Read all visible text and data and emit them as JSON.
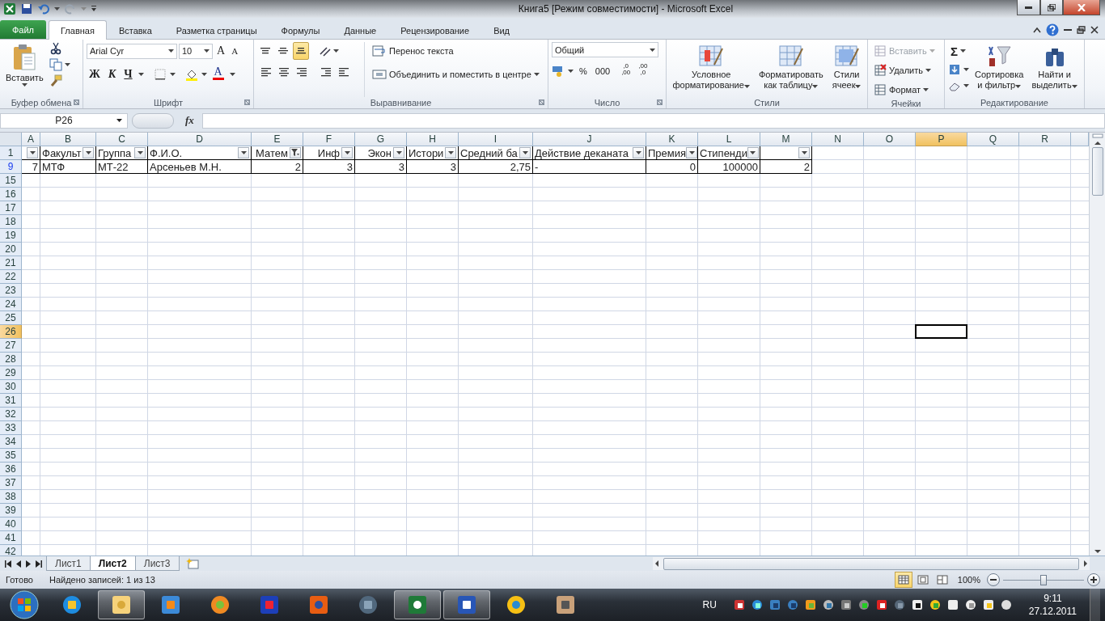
{
  "window": {
    "title": "Книга5  [Режим совместимости]  -  Microsoft Excel"
  },
  "tabs": [
    {
      "label": "Файл",
      "kind": "file",
      "selected": false
    },
    {
      "label": "Главная",
      "kind": "tab",
      "selected": true
    },
    {
      "label": "Вставка",
      "kind": "tab",
      "selected": false
    },
    {
      "label": "Разметка страницы",
      "kind": "tab",
      "selected": false
    },
    {
      "label": "Формулы",
      "kind": "tab",
      "selected": false
    },
    {
      "label": "Данные",
      "kind": "tab",
      "selected": false
    },
    {
      "label": "Рецензирование",
      "kind": "tab",
      "selected": false
    },
    {
      "label": "Вид",
      "kind": "tab",
      "selected": false
    }
  ],
  "ribbon": {
    "clipboard": {
      "title": "Буфер обмена",
      "paste": "Вставить"
    },
    "font": {
      "title": "Шрифт",
      "name": "Arial Cyr",
      "size": "10",
      "grow": "A",
      "shrink": "A",
      "bold": "Ж",
      "italic": "К",
      "underline": "Ч",
      "color_letter": "A"
    },
    "alignment": {
      "title": "Выравнивание",
      "wrap": "Перенос текста",
      "merge": "Объединить и поместить в центре",
      "vertical": [
        {
          "selected": false
        },
        {
          "selected": false
        },
        {
          "selected": true
        }
      ]
    },
    "number": {
      "title": "Число",
      "format": "Общий",
      "percent": "%",
      "thousands": "000",
      "more_decimals": [
        ",0",
        ",00"
      ],
      "fewer_decimals": [
        ",00",
        ",0"
      ]
    },
    "styles": {
      "title": "Стили",
      "buttons": [
        {
          "lines": [
            "Условное",
            "форматирование"
          ]
        },
        {
          "lines": [
            "Форматировать",
            "как таблицу"
          ]
        },
        {
          "lines": [
            "Стили",
            "ячеек"
          ]
        }
      ]
    },
    "cells": {
      "title": "Ячейки",
      "buttons": [
        {
          "label": "Вставить",
          "disabled": true
        },
        {
          "label": "Удалить",
          "disabled": false
        },
        {
          "label": "Формат",
          "disabled": false
        }
      ]
    },
    "editing": {
      "title": "Редактирование",
      "sigma": "Σ",
      "buttons": [
        {
          "lines": [
            "Сортировка",
            "и фильтр"
          ]
        },
        {
          "lines": [
            "Найти и",
            "выделить"
          ]
        }
      ]
    }
  },
  "formula_bar": {
    "name_box": "P26",
    "function_label": "fx"
  },
  "sheet": {
    "columns": [
      {
        "label": "A",
        "selected": false
      },
      {
        "label": "B",
        "selected": false
      },
      {
        "label": "C",
        "selected": false
      },
      {
        "label": "D",
        "selected": false
      },
      {
        "label": "E",
        "selected": false
      },
      {
        "label": "F",
        "selected": false
      },
      {
        "label": "G",
        "selected": false
      },
      {
        "label": "H",
        "selected": false
      },
      {
        "label": "I",
        "selected": false
      },
      {
        "label": "J",
        "selected": false
      },
      {
        "label": "K",
        "selected": false
      },
      {
        "label": "L",
        "selected": false
      },
      {
        "label": "M",
        "selected": false
      },
      {
        "label": "N",
        "selected": false
      },
      {
        "label": "O",
        "selected": false
      },
      {
        "label": "P",
        "selected": true
      },
      {
        "label": "Q",
        "selected": false
      },
      {
        "label": "R",
        "selected": false
      }
    ],
    "rows": [
      {
        "number": "1",
        "selected": false,
        "filtered": false,
        "cells": [
          {
            "right_aligned": false,
            "filter": true,
            "filter_applied": false
          },
          {
            "text": "Факульт",
            "right_aligned": false,
            "filter": true,
            "filter_applied": false
          },
          {
            "text": "Группа",
            "right_aligned": false,
            "filter": true,
            "filter_applied": false
          },
          {
            "text": "Ф.И.О.",
            "right_aligned": false,
            "filter": true,
            "filter_applied": false
          },
          {
            "text": "Матем",
            "right_aligned": true,
            "filter": true,
            "filter_applied": true
          },
          {
            "text": "Инф",
            "right_aligned": true,
            "filter": true,
            "filter_applied": false
          },
          {
            "text": "Экон",
            "right_aligned": true,
            "filter": true,
            "filter_applied": false
          },
          {
            "text": "Истори",
            "right_aligned": false,
            "filter": true,
            "filter_applied": false
          },
          {
            "text": "Средний ба",
            "right_aligned": false,
            "filter": true,
            "filter_applied": false
          },
          {
            "text": "Действие деканата",
            "right_aligned": false,
            "filter": true,
            "filter_applied": false
          },
          {
            "text": "Премия",
            "right_aligned": false,
            "filter": true,
            "filter_applied": false
          },
          {
            "text": "Стипенди",
            "right_aligned": false,
            "filter": true,
            "filter_applied": false
          },
          {
            "right_aligned": false,
            "filter": true,
            "filter_applied": false
          }
        ]
      },
      {
        "number": "9",
        "selected": false,
        "filtered": true,
        "cells": [
          {
            "text": "7",
            "right_aligned": true,
            "filter": false
          },
          {
            "text": "МТФ",
            "right_aligned": false,
            "filter": false
          },
          {
            "text": "МТ-22",
            "right_aligned": false,
            "filter": false
          },
          {
            "text": "Арсеньев М.Н.",
            "right_aligned": false,
            "filter": false
          },
          {
            "text": "2",
            "right_aligned": true,
            "filter": false
          },
          {
            "text": "3",
            "right_aligned": true,
            "filter": false
          },
          {
            "text": "3",
            "right_aligned": true,
            "filter": false
          },
          {
            "text": "3",
            "right_aligned": true,
            "filter": false
          },
          {
            "text": "2,75",
            "right_aligned": true,
            "filter": false
          },
          {
            "text": "-",
            "right_aligned": false,
            "filter": false
          },
          {
            "text": "0",
            "right_aligned": true,
            "filter": false
          },
          {
            "text": "100000",
            "right_aligned": true,
            "filter": false
          },
          {
            "text": "2",
            "right_aligned": true,
            "filter": false
          }
        ]
      },
      {
        "number": "15",
        "selected": false,
        "filtered": false
      },
      {
        "number": "16",
        "selected": false,
        "filtered": false
      },
      {
        "number": "17",
        "selected": false,
        "filtered": false
      },
      {
        "number": "18",
        "selected": false,
        "filtered": false
      },
      {
        "number": "19",
        "selected": false,
        "filtered": false
      },
      {
        "number": "20",
        "selected": false,
        "filtered": false
      },
      {
        "number": "21",
        "selected": false,
        "filtered": false
      },
      {
        "number": "22",
        "selected": false,
        "filtered": false
      },
      {
        "number": "23",
        "selected": false,
        "filtered": false
      },
      {
        "number": "24",
        "selected": false,
        "filtered": false
      },
      {
        "number": "25",
        "selected": false,
        "filtered": false
      },
      {
        "number": "26",
        "selected": true,
        "filtered": false
      },
      {
        "number": "27",
        "selected": false,
        "filtered": false
      },
      {
        "number": "28",
        "selected": false,
        "filtered": false
      },
      {
        "number": "29",
        "selected": false,
        "filtered": false
      },
      {
        "number": "30",
        "selected": false,
        "filtered": false
      },
      {
        "number": "31",
        "selected": false,
        "filtered": false
      },
      {
        "number": "32",
        "selected": false,
        "filtered": false
      },
      {
        "number": "33",
        "selected": false,
        "filtered": false
      },
      {
        "number": "34",
        "selected": false,
        "filtered": false
      },
      {
        "number": "35",
        "selected": false,
        "filtered": false
      },
      {
        "number": "36",
        "selected": false,
        "filtered": false
      },
      {
        "number": "37",
        "selected": false,
        "filtered": false
      },
      {
        "number": "38",
        "selected": false,
        "filtered": false
      },
      {
        "number": "39",
        "selected": false,
        "filtered": false
      },
      {
        "number": "40",
        "selected": false,
        "filtered": false
      },
      {
        "number": "41",
        "selected": false,
        "filtered": false
      },
      {
        "number": "42",
        "selected": false,
        "filtered": false
      }
    ]
  },
  "sheet_tabs": [
    {
      "label": "Лист1",
      "selected": false
    },
    {
      "label": "Лист2",
      "selected": true
    },
    {
      "label": "Лист3",
      "selected": false
    }
  ],
  "status_bar": {
    "ready": "Готово",
    "records": "Найдено записей: 1 из 13",
    "views": [
      {
        "selected": true
      },
      {
        "selected": false
      },
      {
        "selected": false
      }
    ],
    "zoom": "100%",
    "zoom_slider": {
      "level": 0.5
    }
  },
  "taskbar": {
    "apps": [
      {
        "open": false
      },
      {
        "open": true
      },
      {
        "open": false
      },
      {
        "open": false
      },
      {
        "open": false
      },
      {
        "open": false
      },
      {
        "open": false
      },
      {
        "open": true
      },
      {
        "open": true
      },
      {
        "open": false
      },
      {
        "open": false
      }
    ],
    "language": "RU",
    "time": "9:11",
    "date": "27.12.2011"
  }
}
